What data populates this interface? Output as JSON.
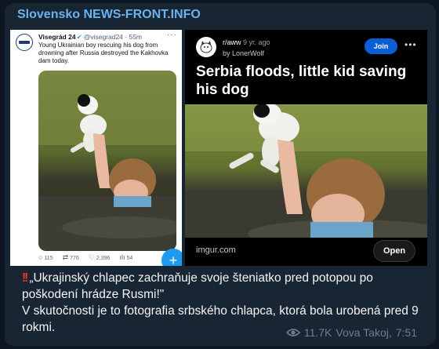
{
  "channel": {
    "name": "Slovensko NEWS-FRONT.INFO"
  },
  "tweet": {
    "author": "Visegrád 24",
    "handle": "@visegrad24 · 55m",
    "text": "Young Ukrainian boy rescuing his dog from drowning after Russia destroyed the Kakhovka dam today.",
    "replies": "115",
    "retweets": "776",
    "likes": "2,396",
    "views": "54"
  },
  "reddit": {
    "subreddit": "r/aww",
    "age": "9 yr. ago",
    "user": "by LonerWolf",
    "join_label": "Join",
    "title": "Serbia floods, little kid saving his dog",
    "domain": "imgur.com",
    "open_label": "Open"
  },
  "caption": {
    "line1": "„Ukrajinský chlapec zachraňuje svoje šteniatko pred potopou po poškodení hrádze Rusmi!\"",
    "line2": "V skutočnosti je to fotografia srbského chlapca, ktorá bola urobená pred 9 rokmi."
  },
  "meta": {
    "views": "11.7K",
    "author": "Vova Takoj",
    "time": "7:51"
  },
  "colors": {
    "accent": "#6ab3f3",
    "bubble": "#182533",
    "join": "#0b5fd6",
    "twitter": "#1d9bf0"
  }
}
